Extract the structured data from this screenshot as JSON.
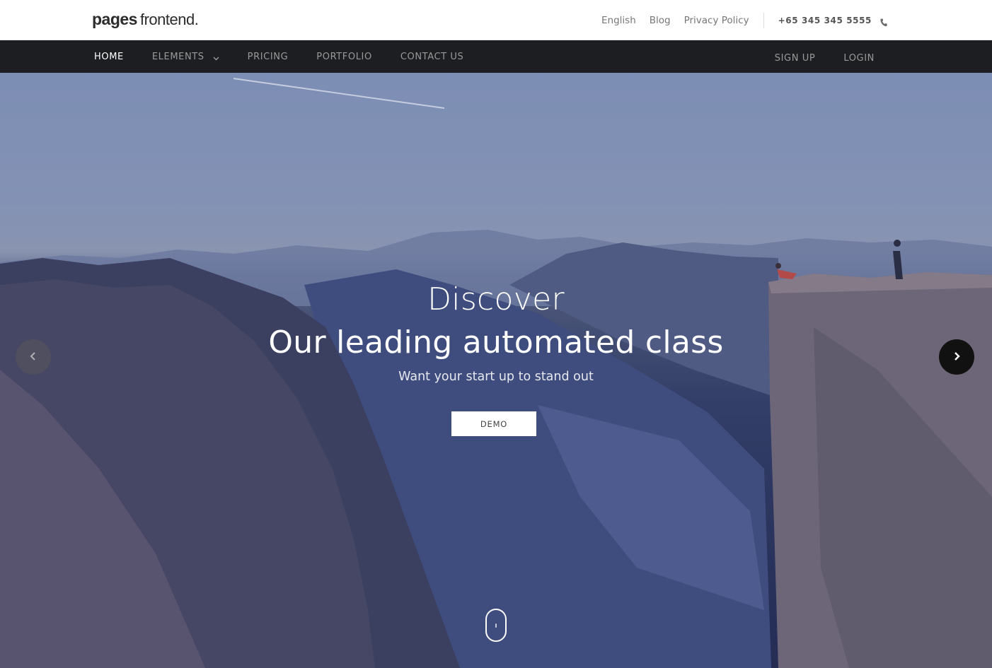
{
  "brand": {
    "part1": "pages",
    "part2": "frontend."
  },
  "topbar": {
    "links": [
      "English",
      "Blog",
      "Privacy Policy"
    ],
    "phone": "+65 345 345 5555",
    "phone_icon": "phone-icon"
  },
  "nav": {
    "items": [
      {
        "label": "HOME",
        "active": true
      },
      {
        "label": "ELEMENTS",
        "dropdown": true
      },
      {
        "label": "PRICING"
      },
      {
        "label": "PORTFOLIO"
      },
      {
        "label": "CONTACT US"
      }
    ],
    "right": [
      "SIGN UP",
      "LOGIN"
    ]
  },
  "hero": {
    "line1": "Discover",
    "line2": "Our leading automated class",
    "subtitle": "Want your start up to stand out",
    "button": "DEMO",
    "prev_icon": "chevron-left-icon",
    "next_icon": "chevron-right-icon",
    "scroll_icon": "mouse-scroll-icon"
  },
  "colors": {
    "navbar_bg": "#1d1e21",
    "nav_active": "#ffffff",
    "nav_inactive": "#9a9a9a",
    "hero_overlay": "#2a3258"
  }
}
